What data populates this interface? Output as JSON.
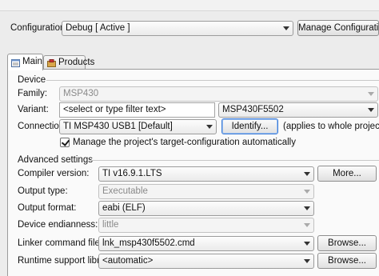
{
  "configuration": {
    "label": "Configuration:",
    "value": "Debug  [ Active ]",
    "manage_button": "Manage Configurations..."
  },
  "tabs": [
    {
      "label": "Main",
      "icon": "main-tab-icon"
    },
    {
      "label": "Products",
      "icon": "products-tab-icon"
    }
  ],
  "device": {
    "section_label": "Device",
    "family_label": "Family:",
    "family_value": "MSP430",
    "variant_label": "Variant:",
    "variant_filter_placeholder": "<select or type filter text>",
    "variant_value": "MSP430F5502",
    "connection_label": "Connection:",
    "connection_value": "TI MSP430 USB1 [Default]",
    "identify_button": "Identify...",
    "identify_note": "(applies to whole project)",
    "manage_target_checkbox_label": "Manage the project's target-configuration automatically",
    "manage_target_checked": true
  },
  "advanced": {
    "section_label": "Advanced settings",
    "compiler_label": "Compiler version:",
    "compiler_value": "TI v16.9.1.LTS",
    "more_button": "More...",
    "output_type_label": "Output type:",
    "output_type_value": "Executable",
    "output_format_label": "Output format:",
    "output_format_value": "eabi (ELF)",
    "endianness_label": "Device endianness:",
    "endianness_value": "little",
    "linker_label": "Linker command file:",
    "linker_value": "lnk_msp430f5502.cmd",
    "linker_browse": "Browse...",
    "runtime_label": "Runtime support library:",
    "runtime_value": "<automatic>",
    "runtime_browse": "Browse..."
  },
  "colors": {
    "focus_border": "#3d7bd6",
    "window_bg": "#ececec",
    "panel_bg": "#fafafa"
  }
}
